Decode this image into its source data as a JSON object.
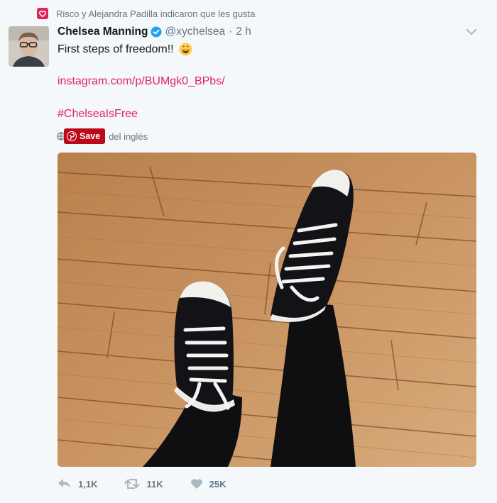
{
  "context": {
    "text": "Risco y Alejandra Padilla indicaron que les gusta",
    "icon": "heart-icon"
  },
  "author": {
    "name": "Chelsea Manning",
    "handle": "@xychelsea",
    "separator": "·",
    "time": "2 h",
    "verified_icon": "verified-badge-icon"
  },
  "content": {
    "text": "First steps of freedom!!",
    "emoji": "grinning-face-emoji",
    "link": "instagram.com/p/BUMgk0_BPbs/",
    "hashtag": "#ChelseaIsFree"
  },
  "translate": {
    "save_label": "Save",
    "text": "del inglés"
  },
  "actions": {
    "reply_count": "1,1K",
    "retweet_count": "11K",
    "like_count": "25K"
  },
  "colors": {
    "accent": "#e0245e",
    "pinterest": "#bd081c",
    "muted": "#657786",
    "verified": "#1da1f2"
  }
}
